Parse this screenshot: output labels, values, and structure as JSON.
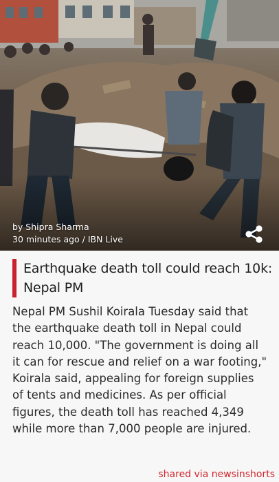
{
  "article": {
    "author": "by Shipra Sharma",
    "meta": "30 minutes ago / IBN Live",
    "headline": "Earthquake death toll could reach 10k: Nepal PM",
    "body": "Nepal PM Sushil Koirala Tuesday said that the earthquake death toll in Nepal could reach 10,000. \"The government is doing all it can for rescue and relief on a war footing,\" Koirala said, appealing for foreign supplies of tents and medicines. As per official figures, the death toll has reached 4,349 while more than 7,000 people are injured."
  },
  "actions": {
    "share_icon": "share-icon"
  },
  "footer": {
    "shared_via": "shared via newsinshorts"
  },
  "colors": {
    "accent": "#c8232c",
    "footer_text": "#d0262e",
    "background": "#f7f7f7"
  }
}
